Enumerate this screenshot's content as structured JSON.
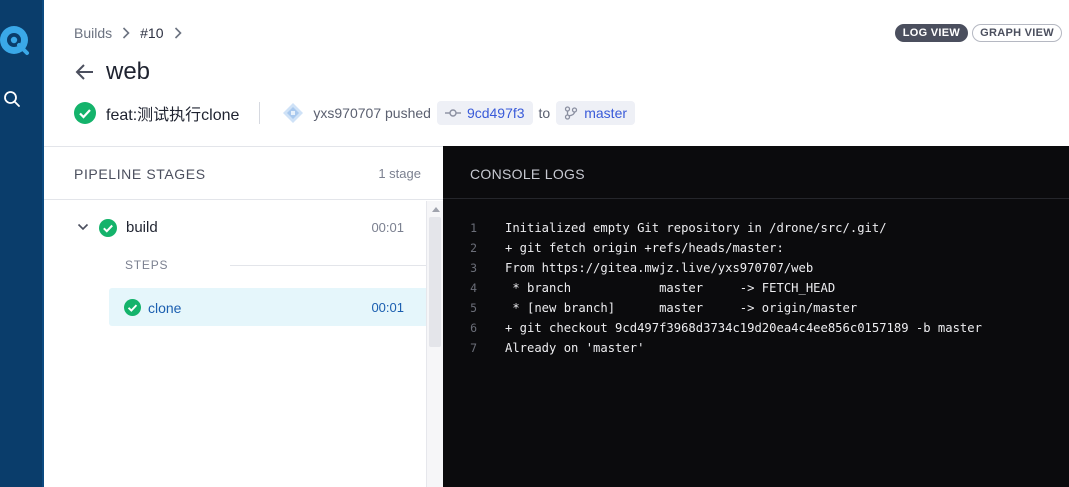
{
  "breadcrumb": {
    "root": "Builds",
    "build_number": "#10"
  },
  "view_toggle": {
    "log_view": "LOG VIEW",
    "graph_view": "GRAPH VIEW"
  },
  "page": {
    "title": "web"
  },
  "commit": {
    "message": "feat:测试执行clone",
    "author": "yxs970707",
    "action": "pushed",
    "sha": "9cd497f3",
    "to_label": "to",
    "branch": "master"
  },
  "pipeline": {
    "heading": "PIPELINE STAGES",
    "stage_count": "1 stage",
    "stage": {
      "name": "build",
      "duration": "00:01"
    },
    "steps_heading": "STEPS",
    "step": {
      "name": "clone",
      "duration": "00:01"
    }
  },
  "console": {
    "heading": "CONSOLE LOGS",
    "lines": [
      {
        "n": "1",
        "text": "Initialized empty Git repository in /drone/src/.git/"
      },
      {
        "n": "2",
        "text": "+ git fetch origin +refs/heads/master:"
      },
      {
        "n": "3",
        "text": "From https://gitea.mwjz.live/yxs970707/web"
      },
      {
        "n": "4",
        "text": " * branch            master     -> FETCH_HEAD"
      },
      {
        "n": "5",
        "text": " * [new branch]      master     -> origin/master"
      },
      {
        "n": "6",
        "text": "+ git checkout 9cd497f3968d3734c19d20ea4c4ee856c0157189 -b master"
      },
      {
        "n": "7",
        "text": "Already on 'master'"
      }
    ]
  },
  "colors": {
    "rail": "#0a3d6b",
    "success": "#14b36b",
    "link": "#3a5bd9",
    "console_bg": "#0b0b0d"
  },
  "icons": [
    "drone-logo-icon",
    "search-icon",
    "chevron-right-icon",
    "arrow-left-icon",
    "check-circle-icon",
    "avatar-icon",
    "commit-icon",
    "branch-icon",
    "chevron-down-icon"
  ]
}
